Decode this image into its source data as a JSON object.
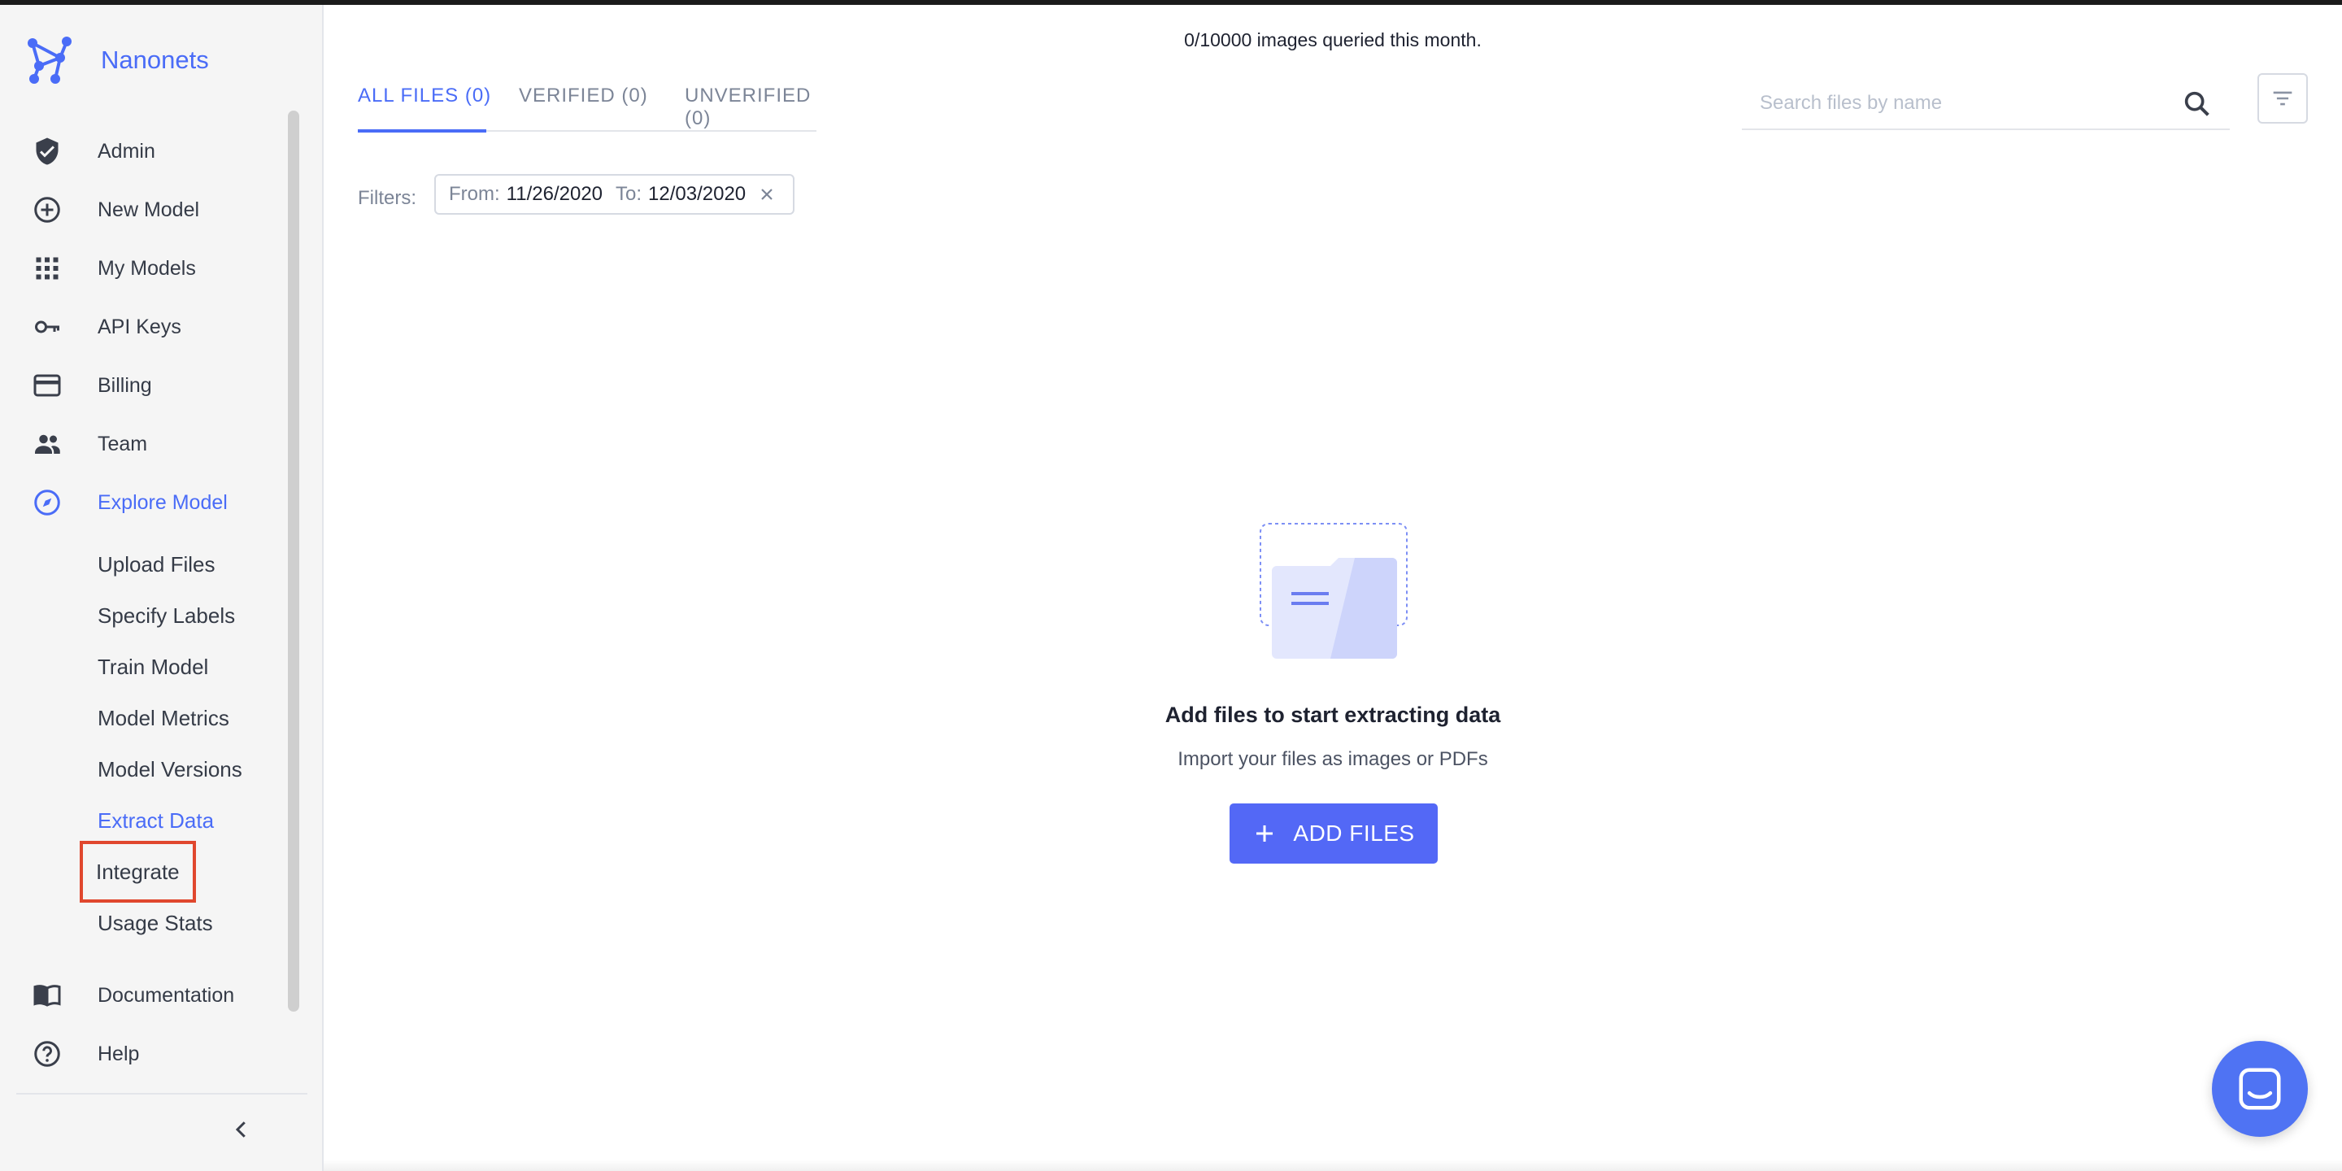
{
  "brand": {
    "name": "Nanonets",
    "logo_icon": "nanonets-logo-icon"
  },
  "sidebar": {
    "items": [
      {
        "label": "Admin",
        "icon": "shield-check-icon"
      },
      {
        "label": "New Model",
        "icon": "add-circle-icon"
      },
      {
        "label": "My Models",
        "icon": "grid-icon"
      },
      {
        "label": "API Keys",
        "icon": "key-icon"
      },
      {
        "label": "Billing",
        "icon": "credit-card-icon"
      },
      {
        "label": "Team",
        "icon": "people-icon"
      },
      {
        "label": "Explore Model",
        "icon": "compass-icon",
        "active": true
      }
    ],
    "subitems": [
      {
        "label": "Upload Files"
      },
      {
        "label": "Specify Labels"
      },
      {
        "label": "Train Model"
      },
      {
        "label": "Model Metrics"
      },
      {
        "label": "Model Versions"
      },
      {
        "label": "Extract Data",
        "active": true
      },
      {
        "label": "Integrate",
        "highlighted": true
      },
      {
        "label": "Usage Stats"
      }
    ],
    "footer_items": [
      {
        "label": "Documentation",
        "icon": "book-icon"
      },
      {
        "label": "Help",
        "icon": "help-circle-icon"
      }
    ],
    "collapse_icon": "chevron-left-icon"
  },
  "header": {
    "quota_text": "0/10000 images queried this month."
  },
  "tabs": [
    {
      "label": "ALL FILES (0)",
      "active": true
    },
    {
      "label": "VERIFIED (0)"
    },
    {
      "label": "UNVERIFIED (0)"
    }
  ],
  "search": {
    "placeholder": "Search files by name",
    "value": "",
    "icon": "search-icon"
  },
  "filter_button_icon": "filter-lines-icon",
  "filters": {
    "label": "Filters:",
    "from_label": "From:",
    "from_value": "11/26/2020",
    "to_label": "To:",
    "to_value": "12/03/2020"
  },
  "empty_state": {
    "title": "Add files to start extracting data",
    "subtitle": "Import your files as images or PDFs",
    "button_label": "ADD FILES"
  },
  "colors": {
    "accent": "#4a6cf7",
    "button": "#5368f6",
    "highlight_box": "#e0472e"
  }
}
